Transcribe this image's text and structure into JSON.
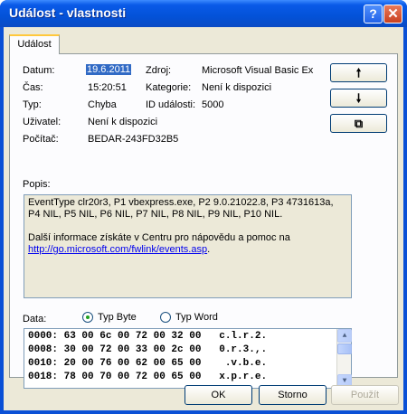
{
  "window": {
    "title": "Událost - vlastnosti",
    "help_icon": "?",
    "close_icon": "✕"
  },
  "tab": {
    "label": "Událost"
  },
  "fields": {
    "datum_label": "Datum:",
    "datum_value": "19.6.2011",
    "zdroj_label": "Zdroj:",
    "zdroj_value": "Microsoft Visual Basic Ex",
    "cas_label": "Čas:",
    "cas_value": "15:20:51",
    "kategorie_label": "Kategorie:",
    "kategorie_value": "Není k dispozici",
    "typ_label": "Typ:",
    "typ_value": "Chyba",
    "id_label": "ID události:",
    "id_value": "5000",
    "uzivatel_label": "Uživatel:",
    "uzivatel_value": "Není k dispozici",
    "pocitac_label": "Počítač:",
    "pocitac_value": "BEDAR-243FD32B5"
  },
  "side_buttons": {
    "up": "🠕",
    "down": "🠗",
    "copy": "⧉"
  },
  "description": {
    "label": "Popis:",
    "line1": "EventType clr20r3, P1 vbexpress.exe, P2 9.0.21022.8, P3 4731613a, P4 NIL, P5 NIL, P6 NIL, P7 NIL, P8 NIL, P9 NIL, P10 NIL.",
    "line2": "Další informace získáte v Centru pro nápovědu a pomoc na",
    "link": "http://go.microsoft.com/fwlink/events.asp",
    "suffix": "."
  },
  "data_section": {
    "label": "Data:",
    "radio_byte": "Typ Byte",
    "radio_word": "Typ Word",
    "selected": "Typ Byte",
    "rows": [
      "0000: 63 00 6c 00 72 00 32 00   c.l.r.2.",
      "0008: 30 00 72 00 33 00 2c 00   0.r.3.,.",
      "0010: 20 00 76 00 62 00 65 00    .v.b.e.",
      "0018: 78 00 70 00 72 00 65 00   x.p.r.e."
    ]
  },
  "buttons": {
    "ok": "OK",
    "storno": "Storno",
    "pouzit": "Použít"
  }
}
